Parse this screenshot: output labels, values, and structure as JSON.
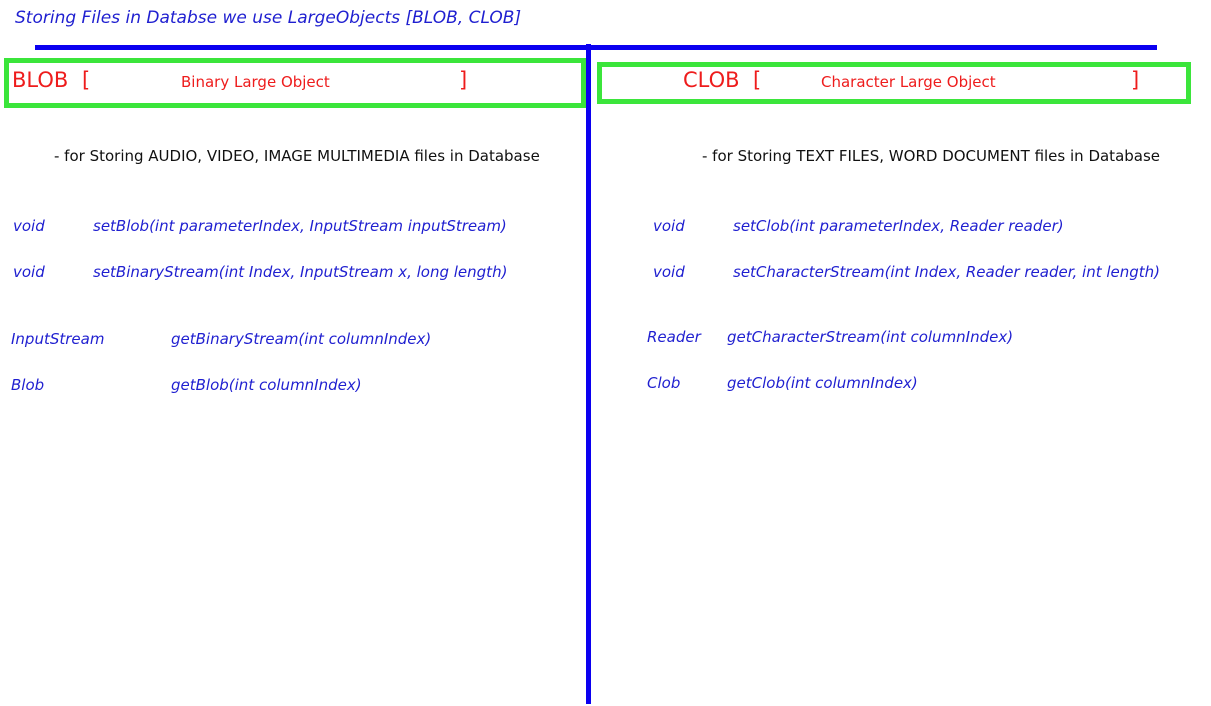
{
  "title": "Storing Files in Databse we use LargeObjects [BLOB, CLOB]",
  "colors": {
    "rule_blue": "#0b00f0",
    "box_green": "#3be53b",
    "heading_red": "#ee1c1c",
    "code_blue": "#1f1fd0"
  },
  "blob": {
    "heading": "BLOB",
    "open_bracket": "[",
    "full_name": "Binary Large Object",
    "close_bracket": "]",
    "description": "- for Storing  AUDIO, VIDEO, IMAGE MULTIMEDIA files in Database",
    "setters": [
      {
        "type": "void",
        "signature": "setBlob(int parameterIndex, InputStream inputStream)"
      },
      {
        "type": "void",
        "signature": "setBinaryStream(int Index, InputStream x, long length)"
      }
    ],
    "getters": [
      {
        "type": "InputStream",
        "signature": "getBinaryStream(int columnIndex)"
      },
      {
        "type": "Blob",
        "signature": "getBlob(int columnIndex)"
      }
    ]
  },
  "clob": {
    "heading": "CLOB",
    "open_bracket": "[",
    "full_name": "Character  Large Object",
    "close_bracket": "]",
    "description": "- for Storing  TEXT FILES, WORD DOCUMENT  files in Database",
    "setters": [
      {
        "type": "void",
        "signature": "setClob(int parameterIndex, Reader reader)"
      },
      {
        "type": "void",
        "signature": "setCharacterStream(int Index, Reader reader, int length)"
      }
    ],
    "getters": [
      {
        "type": "Reader",
        "signature": "getCharacterStream(int columnIndex)"
      },
      {
        "type": "Clob",
        "signature": "getClob(int columnIndex)"
      }
    ]
  }
}
